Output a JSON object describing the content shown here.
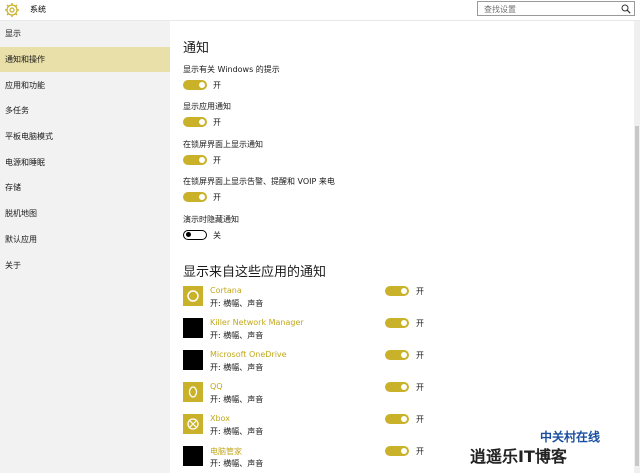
{
  "window": {
    "title": "系统",
    "icon": "gear-icon"
  },
  "search": {
    "placeholder": "查找设置",
    "icon": "search-icon"
  },
  "sidebar": {
    "items": [
      {
        "label": "显示",
        "active": false
      },
      {
        "label": "通知和操作",
        "active": true
      },
      {
        "label": "应用和功能",
        "active": false
      },
      {
        "label": "多任务",
        "active": false
      },
      {
        "label": "平板电脑模式",
        "active": false
      },
      {
        "label": "电源和睡眠",
        "active": false
      },
      {
        "label": "存储",
        "active": false
      },
      {
        "label": "脱机地图",
        "active": false
      },
      {
        "label": "默认应用",
        "active": false
      },
      {
        "label": "关于",
        "active": false
      }
    ]
  },
  "notifications": {
    "heading": "通知",
    "settings": [
      {
        "label": "显示有关 Windows 的提示",
        "state": "开",
        "on": true
      },
      {
        "label": "显示应用通知",
        "state": "开",
        "on": true
      },
      {
        "label": "在锁屏界面上显示通知",
        "state": "开",
        "on": true
      },
      {
        "label": "在锁屏界面上显示告警、提醒和 VOIP 来电",
        "state": "开",
        "on": true
      },
      {
        "label": "演示时隐藏通知",
        "state": "关",
        "on": false
      }
    ]
  },
  "apps": {
    "heading": "显示来自这些应用的通知",
    "items": [
      {
        "name": "Cortana",
        "detail": "开: 横幅、声音",
        "state": "开",
        "icon": "cortana-icon"
      },
      {
        "name": "Killer Network Manager",
        "detail": "开: 横幅、声音",
        "state": "开",
        "icon": "app-icon"
      },
      {
        "name": "Microsoft OneDrive",
        "detail": "开: 横幅、声音",
        "state": "开",
        "icon": "app-icon"
      },
      {
        "name": "QQ",
        "detail": "开: 横幅、声音",
        "state": "开",
        "icon": "qq-icon"
      },
      {
        "name": "Xbox",
        "detail": "开: 横幅、声音",
        "state": "开",
        "icon": "xbox-icon"
      },
      {
        "name": "电脑管家",
        "detail": "开: 横幅、声音",
        "state": "开",
        "icon": "app-icon"
      }
    ]
  },
  "watermark": {
    "line1": "中关村在线",
    "line2": "逍遥乐IT博客"
  },
  "colors": {
    "accent": "#c9b12a",
    "active_nav": "#e9dfa8"
  }
}
